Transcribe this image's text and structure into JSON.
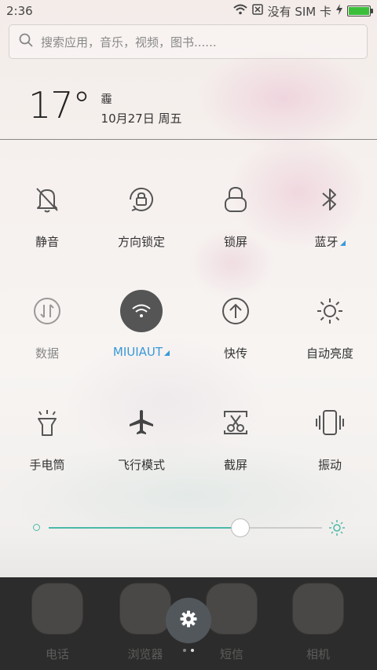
{
  "status_bar": {
    "time": "2:36",
    "carrier": "没有 SIM 卡"
  },
  "search": {
    "placeholder": "搜索应用，音乐，视频，图书......"
  },
  "weather": {
    "temperature": "17°",
    "condition": "霾",
    "date": "10月27日 周五"
  },
  "toggles": [
    {
      "label": "静音",
      "icon": "bell-off-icon",
      "state": "off"
    },
    {
      "label": "方向锁定",
      "icon": "rotation-lock-icon",
      "state": "off"
    },
    {
      "label": "锁屏",
      "icon": "lock-icon",
      "state": "off"
    },
    {
      "label": "蓝牙",
      "icon": "bluetooth-icon",
      "state": "off"
    },
    {
      "label": "数据",
      "icon": "data-arrows-icon",
      "state": "disabled"
    },
    {
      "label": "MIUIAUT",
      "icon": "wifi-icon",
      "state": "on"
    },
    {
      "label": "快传",
      "icon": "upload-icon",
      "state": "off"
    },
    {
      "label": "自动亮度",
      "icon": "sun-icon",
      "state": "off"
    },
    {
      "label": "手电筒",
      "icon": "flashlight-icon",
      "state": "off"
    },
    {
      "label": "飞行模式",
      "icon": "airplane-icon",
      "state": "off"
    },
    {
      "label": "截屏",
      "icon": "screenshot-scissors-icon",
      "state": "off"
    },
    {
      "label": "振动",
      "icon": "vibrate-icon",
      "state": "off"
    }
  ],
  "brightness": {
    "level": 0.7
  },
  "dock": {
    "apps": [
      {
        "label": "电话"
      },
      {
        "label": "浏览器"
      },
      {
        "label": "短信"
      },
      {
        "label": "相机"
      }
    ]
  },
  "colors": {
    "accent": "#4bb9a8",
    "active_tile": "#555555",
    "wifi_label": "#3a98d8",
    "battery": "#3bbf3b"
  }
}
